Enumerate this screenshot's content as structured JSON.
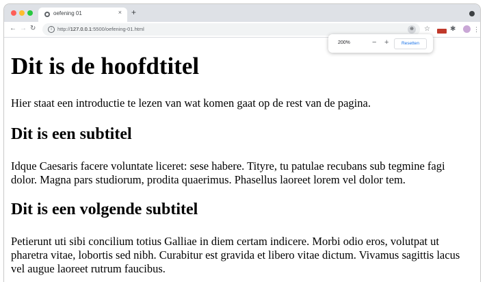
{
  "browser": {
    "tab_title": "oefening 01",
    "tab_close": "×",
    "new_tab": "+",
    "url_scheme": "http://",
    "url_host": "127.0.0.1",
    "url_rest": ":5500/oefening-01.html",
    "nav_back": "←",
    "nav_forward": "→",
    "nav_reload": "↻",
    "info_glyph": "i",
    "zoom_glyph": "⊕",
    "star_glyph": "☆",
    "puzzle_glyph": "✱",
    "menu_glyph": "⋮"
  },
  "zoom_popup": {
    "level": "200%",
    "minus": "−",
    "plus": "+",
    "reset_label": "Resetten"
  },
  "page": {
    "h1": "Dit is de hoofdtitel",
    "p1": "Hier staat een introductie te lezen van wat komen gaat op de rest van de pagina.",
    "h2a": "Dit is een subtitel",
    "p2": "Idque Caesaris facere voluntate liceret: sese habere. Tityre, tu patulae recubans sub tegmine fagi dolor. Magna pars studiorum, prodita quaerimus. Phasellus laoreet lorem vel dolor tem.",
    "h2b": "Dit is een volgende subtitel",
    "p3": "Petierunt uti sibi concilium totius Galliae in diem certam indicere. Morbi odio eros, volutpat ut pharetra vitae, lobortis sed nibh. Curabitur est gravida et libero vitae dictum. Vivamus sagittis lacus vel augue laoreet rutrum faucibus."
  },
  "colors": {
    "tabstrip": "#dee1e6",
    "accent": "#1a73e8",
    "traffic_red": "#fe5f57",
    "traffic_yellow": "#febc2e",
    "traffic_green": "#28c840"
  }
}
